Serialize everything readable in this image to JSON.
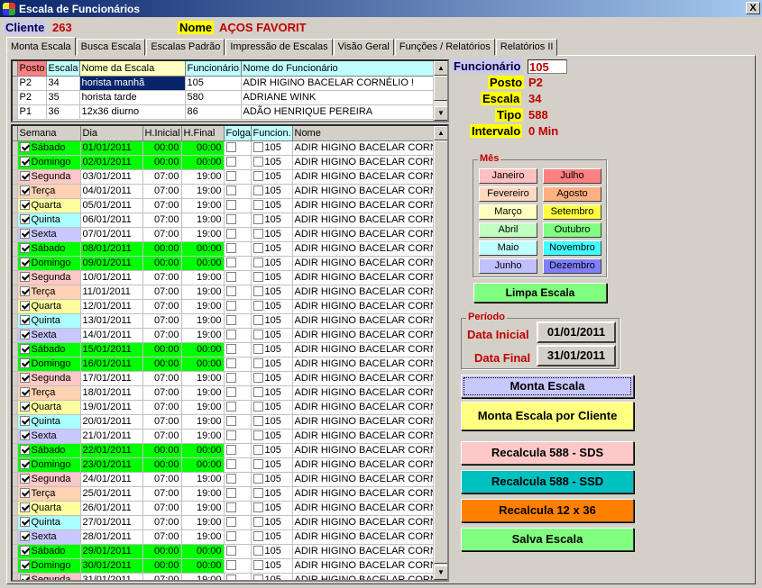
{
  "window": {
    "title": "Escala de Funcionários",
    "close": "X"
  },
  "header": {
    "cliente_label": "Cliente",
    "cliente_value": "263",
    "nome_label": "Nome",
    "nome_value": "AÇOS FAVORIT"
  },
  "tabs": [
    "Monta Escala",
    "Busca Escala",
    "Escalas Padrão",
    "Impressão de Escalas",
    "Visão Geral",
    "Funções / Relatórios",
    "Relatórios II"
  ],
  "top_grid": {
    "columns": [
      "Posto",
      "Escala",
      "Nome da  Escala",
      "Funcionário",
      "Nome do Funcionário"
    ],
    "rows": [
      [
        "P2",
        "34",
        "horista manhã",
        "105",
        "ADIR HIGINO BACELAR CORNÉLIO !"
      ],
      [
        "P2",
        "35",
        "horista tarde",
        "580",
        "ADRIANE WINK"
      ],
      [
        "P1",
        "36",
        "12x36 diurno",
        "86",
        "ADÃO HENRIQUE PEREIRA"
      ]
    ]
  },
  "info": {
    "funcionario_label": "Funcionário",
    "funcionario_value": "105",
    "posto_label": "Posto",
    "posto_value": "P2",
    "escala_label": "Escala",
    "escala_value": "34",
    "tipo_label": "Tipo",
    "tipo_value": "588",
    "intervalo_label": "Intervalo",
    "intervalo_value": "0 Min"
  },
  "main_grid": {
    "columns": [
      "Semana",
      "Dia",
      "H.Inicial",
      "H.Final",
      "Folga",
      "Funcion.",
      "Nome"
    ],
    "rows": [
      {
        "dia": "Sábado",
        "data": "01/01/2011",
        "hi": "00:00",
        "hf": "00:00",
        "func": "105",
        "nome": "ADIR HIGINO BACELAR CORN",
        "off": true
      },
      {
        "dia": "Domingo",
        "data": "02/01/2011",
        "hi": "00:00",
        "hf": "00:00",
        "func": "105",
        "nome": "ADIR HIGINO BACELAR CORN",
        "off": true
      },
      {
        "dia": "Segunda",
        "data": "03/01/2011",
        "hi": "07:00",
        "hf": "19:00",
        "func": "105",
        "nome": "ADIR HIGINO BACELAR CORN",
        "off": false
      },
      {
        "dia": "Terça",
        "data": "04/01/2011",
        "hi": "07:00",
        "hf": "19:00",
        "func": "105",
        "nome": "ADIR HIGINO BACELAR CORN",
        "off": false
      },
      {
        "dia": "Quarta",
        "data": "05/01/2011",
        "hi": "07:00",
        "hf": "19:00",
        "func": "105",
        "nome": "ADIR HIGINO BACELAR CORN",
        "off": false
      },
      {
        "dia": "Quinta",
        "data": "06/01/2011",
        "hi": "07:00",
        "hf": "19:00",
        "func": "105",
        "nome": "ADIR HIGINO BACELAR CORN",
        "off": false
      },
      {
        "dia": "Sexta",
        "data": "07/01/2011",
        "hi": "07:00",
        "hf": "19:00",
        "func": "105",
        "nome": "ADIR HIGINO BACELAR CORN",
        "off": false
      },
      {
        "dia": "Sábado",
        "data": "08/01/2011",
        "hi": "00:00",
        "hf": "00:00",
        "func": "105",
        "nome": "ADIR HIGINO BACELAR CORN",
        "off": true
      },
      {
        "dia": "Domingo",
        "data": "09/01/2011",
        "hi": "00:00",
        "hf": "00:00",
        "func": "105",
        "nome": "ADIR HIGINO BACELAR CORN",
        "off": true
      },
      {
        "dia": "Segunda",
        "data": "10/01/2011",
        "hi": "07:00",
        "hf": "19:00",
        "func": "105",
        "nome": "ADIR HIGINO BACELAR CORN",
        "off": false
      },
      {
        "dia": "Terça",
        "data": "11/01/2011",
        "hi": "07:00",
        "hf": "19:00",
        "func": "105",
        "nome": "ADIR HIGINO BACELAR CORN",
        "off": false
      },
      {
        "dia": "Quarta",
        "data": "12/01/2011",
        "hi": "07:00",
        "hf": "19:00",
        "func": "105",
        "nome": "ADIR HIGINO BACELAR CORN",
        "off": false
      },
      {
        "dia": "Quinta",
        "data": "13/01/2011",
        "hi": "07:00",
        "hf": "19:00",
        "func": "105",
        "nome": "ADIR HIGINO BACELAR CORN",
        "off": false
      },
      {
        "dia": "Sexta",
        "data": "14/01/2011",
        "hi": "07:00",
        "hf": "19:00",
        "func": "105",
        "nome": "ADIR HIGINO BACELAR CORN",
        "off": false
      },
      {
        "dia": "Sábado",
        "data": "15/01/2011",
        "hi": "00:00",
        "hf": "00:00",
        "func": "105",
        "nome": "ADIR HIGINO BACELAR CORN",
        "off": true
      },
      {
        "dia": "Domingo",
        "data": "16/01/2011",
        "hi": "00:00",
        "hf": "00:00",
        "func": "105",
        "nome": "ADIR HIGINO BACELAR CORN",
        "off": true
      },
      {
        "dia": "Segunda",
        "data": "17/01/2011",
        "hi": "07:00",
        "hf": "19:00",
        "func": "105",
        "nome": "ADIR HIGINO BACELAR CORN",
        "off": false
      },
      {
        "dia": "Terça",
        "data": "18/01/2011",
        "hi": "07:00",
        "hf": "19:00",
        "func": "105",
        "nome": "ADIR HIGINO BACELAR CORN",
        "off": false
      },
      {
        "dia": "Quarta",
        "data": "19/01/2011",
        "hi": "07:00",
        "hf": "19:00",
        "func": "105",
        "nome": "ADIR HIGINO BACELAR CORN",
        "off": false
      },
      {
        "dia": "Quinta",
        "data": "20/01/2011",
        "hi": "07:00",
        "hf": "19:00",
        "func": "105",
        "nome": "ADIR HIGINO BACELAR CORN",
        "off": false
      },
      {
        "dia": "Sexta",
        "data": "21/01/2011",
        "hi": "07:00",
        "hf": "19:00",
        "func": "105",
        "nome": "ADIR HIGINO BACELAR CORN",
        "off": false
      },
      {
        "dia": "Sábado",
        "data": "22/01/2011",
        "hi": "00:00",
        "hf": "00:00",
        "func": "105",
        "nome": "ADIR HIGINO BACELAR CORN",
        "off": true
      },
      {
        "dia": "Domingo",
        "data": "23/01/2011",
        "hi": "00:00",
        "hf": "00:00",
        "func": "105",
        "nome": "ADIR HIGINO BACELAR CORN",
        "off": true
      },
      {
        "dia": "Segunda",
        "data": "24/01/2011",
        "hi": "07:00",
        "hf": "19:00",
        "func": "105",
        "nome": "ADIR HIGINO BACELAR CORN",
        "off": false
      },
      {
        "dia": "Terça",
        "data": "25/01/2011",
        "hi": "07:00",
        "hf": "19:00",
        "func": "105",
        "nome": "ADIR HIGINO BACELAR CORN",
        "off": false
      },
      {
        "dia": "Quarta",
        "data": "26/01/2011",
        "hi": "07:00",
        "hf": "19:00",
        "func": "105",
        "nome": "ADIR HIGINO BACELAR CORN",
        "off": false
      },
      {
        "dia": "Quinta",
        "data": "27/01/2011",
        "hi": "07:00",
        "hf": "19:00",
        "func": "105",
        "nome": "ADIR HIGINO BACELAR CORN",
        "off": false
      },
      {
        "dia": "Sexta",
        "data": "28/01/2011",
        "hi": "07:00",
        "hf": "19:00",
        "func": "105",
        "nome": "ADIR HIGINO BACELAR CORN",
        "off": false
      },
      {
        "dia": "Sábado",
        "data": "29/01/2011",
        "hi": "00:00",
        "hf": "00:00",
        "func": "105",
        "nome": "ADIR HIGINO BACELAR CORN",
        "off": true
      },
      {
        "dia": "Domingo",
        "data": "30/01/2011",
        "hi": "00:00",
        "hf": "00:00",
        "func": "105",
        "nome": "ADIR HIGINO BACELAR CORN",
        "off": true
      },
      {
        "dia": "Segunda",
        "data": "31/01/2011",
        "hi": "07:00",
        "hf": "19:00",
        "func": "105",
        "nome": "ADIR HIGINO BACELAR CORN",
        "off": false
      }
    ]
  },
  "day_colors": {
    "Sábado": "#00ff00",
    "Domingo": "#00ff00",
    "Segunda": "#ffc8c8",
    "Terça": "#ffd2b4",
    "Quarta": "#ffffa0",
    "Quinta": "#aaffff",
    "Sexta": "#c8c8ff"
  },
  "mes": {
    "title": "Mês",
    "months": [
      {
        "label": "Janeiro",
        "color": "#ffc0c0"
      },
      {
        "label": "Julho",
        "color": "#ff8080"
      },
      {
        "label": "Fevereiro",
        "color": "#ffd8c0"
      },
      {
        "label": "Agosto",
        "color": "#ffb080"
      },
      {
        "label": "Março",
        "color": "#ffffc0"
      },
      {
        "label": "Setembro",
        "color": "#ffff40"
      },
      {
        "label": "Abril",
        "color": "#c0ffc0"
      },
      {
        "label": "Outubro",
        "color": "#80ff80"
      },
      {
        "label": "Maio",
        "color": "#c0ffff"
      },
      {
        "label": "Novembro",
        "color": "#40ffff"
      },
      {
        "label": "Junho",
        "color": "#c0c0ff"
      },
      {
        "label": "Dezembro",
        "color": "#8080ff"
      }
    ]
  },
  "limpa": "Limpa Escala",
  "periodo": {
    "title": "Período",
    "inicial_label": "Data Inicial",
    "inicial": "01/01/2011",
    "final_label": "Data Final",
    "final": "31/01/2011"
  },
  "buttons": {
    "monta": "Monta Escala",
    "monta_cliente": "Monta Escala por Cliente",
    "sds": "Recalcula 588 - SDS",
    "ssd": "Recalcula 588 - SSD",
    "r12x36": "Recalcula 12 x 36",
    "salva": "Salva Escala"
  },
  "colors": {
    "monta": "#c8c8ff",
    "monta_cliente": "#ffff80",
    "sds": "#ffc8c8",
    "ssd": "#00c0c0",
    "r12x36": "#ff8000",
    "salva": "#80ff80",
    "limpa": "#80ff80"
  }
}
